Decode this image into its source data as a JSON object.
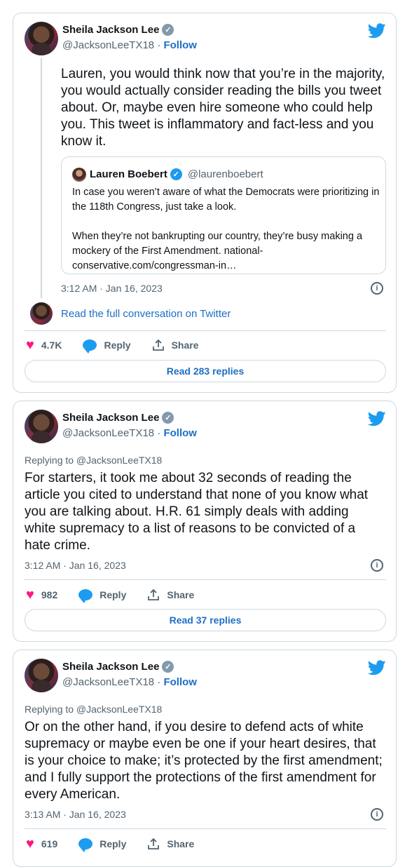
{
  "tweets": [
    {
      "author": "Sheila Jackson Lee",
      "handle": "@JacksonLeeTX18",
      "follow": "Follow",
      "text": "Lauren, you would think now that you’re in the majority, you would actually consider reading the bills you tweet about. Or, maybe even hire someone who could help you. This tweet is inflammatory and fact-less and you know it.",
      "quote": {
        "author": "Lauren Boebert",
        "handle": "@laurenboebert",
        "text1": "In case you weren’t aware of what the Democrats were prioritizing in the 118th Congress, just take a look.",
        "text2": "When they’re not bankrupting our country, they’re busy making a mockery of the First Amendment. national-conservative.com/congressman-in…"
      },
      "timestamp": "3:12 AM · Jan 16, 2023",
      "conversation_link": "Read the full conversation on Twitter",
      "likes": "4.7K",
      "reply": "Reply",
      "share": "Share",
      "read_replies": "Read 283 replies"
    },
    {
      "author": "Sheila Jackson Lee",
      "handle": "@JacksonLeeTX18",
      "follow": "Follow",
      "replying_to": "Replying to @JacksonLeeTX18",
      "text": "For starters, it took me about 32 seconds of reading the article you cited to understand that none of you know what you are talking about. H.R. 61 simply deals with adding white supremacy to a list of reasons to be convicted of a hate crime.",
      "timestamp": "3:12 AM · Jan 16, 2023",
      "likes": "982",
      "reply": "Reply",
      "share": "Share",
      "read_replies": "Read 37 replies"
    },
    {
      "author": "Sheila Jackson Lee",
      "handle": "@JacksonLeeTX18",
      "follow": "Follow",
      "replying_to": "Replying to @JacksonLeeTX18",
      "text": "Or on the other hand, if you desire to defend acts of white supremacy or maybe even be one if your heart desires, that is your choice to make; it’s protected by the first amendment; and I fully support the protections of the first amendment for every American.",
      "timestamp": "3:13 AM · Jan 16, 2023",
      "likes": "619",
      "reply": "Reply",
      "share": "Share"
    }
  ],
  "colors": {
    "accent": "#1d9bf0",
    "like": "#f91880",
    "link": "#1d6fc4",
    "muted": "#536471"
  }
}
